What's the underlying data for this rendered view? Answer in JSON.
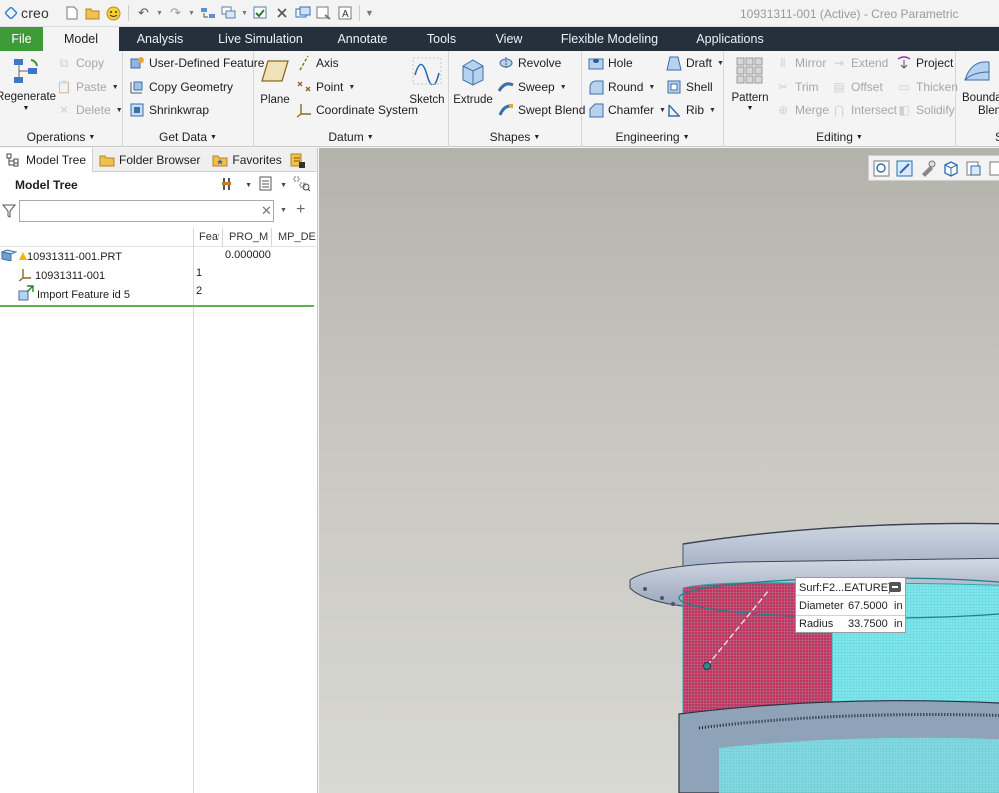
{
  "app": {
    "logo_text": "creo",
    "window_title": "10931311-001 (Active) - Creo Parametric"
  },
  "quick_access": [
    "new-icon",
    "open-icon",
    "smiley-icon",
    "undo-icon",
    "redo-icon",
    "regenerate-icon",
    "windows-icon",
    "check-icon",
    "close-window-icon",
    "switch-window-icon",
    "erase-icon",
    "text-style-icon",
    "customize-icon"
  ],
  "tabs": [
    {
      "label": "File"
    },
    {
      "label": "Model"
    },
    {
      "label": "Analysis"
    },
    {
      "label": "Live Simulation"
    },
    {
      "label": "Annotate"
    },
    {
      "label": "Tools"
    },
    {
      "label": "View"
    },
    {
      "label": "Flexible Modeling"
    },
    {
      "label": "Applications"
    }
  ],
  "ribbon": {
    "operations": {
      "label": "Operations",
      "regenerate": "Regenerate",
      "copy": "Copy",
      "paste": "Paste",
      "delete": "Delete"
    },
    "get_data": {
      "label": "Get Data",
      "udf": "User-Defined Feature",
      "copy_geometry": "Copy Geometry",
      "shrinkwrap": "Shrinkwrap"
    },
    "datum": {
      "label": "Datum",
      "plane": "Plane",
      "axis": "Axis",
      "point": "Point",
      "coordinate_system": "Coordinate System",
      "sketch": "Sketch"
    },
    "shapes": {
      "label": "Shapes",
      "extrude": "Extrude",
      "revolve": "Revolve",
      "sweep": "Sweep",
      "swept_blend": "Swept Blend"
    },
    "engineering": {
      "label": "Engineering",
      "hole": "Hole",
      "round": "Round",
      "chamfer": "Chamfer",
      "draft": "Draft",
      "shell": "Shell",
      "rib": "Rib"
    },
    "editing": {
      "label": "Editing",
      "pattern": "Pattern",
      "mirror": "Mirror",
      "trim": "Trim",
      "merge": "Merge",
      "extend": "Extend",
      "offset": "Offset",
      "intersect": "Intersect",
      "project": "Project",
      "thicken": "Thicken",
      "solidify": "Solidify"
    },
    "surfaces": {
      "boundary_blend_line1": "Bounda",
      "boundary_blend_line2": "Blend",
      "label_fragment": "S"
    }
  },
  "left_panel": {
    "tabs": [
      "Model Tree",
      "Folder Browser",
      "Favorites"
    ],
    "title": "Model Tree",
    "search": {
      "value": "",
      "placeholder": ""
    },
    "columns": [
      "Feat",
      "PRO_MP",
      "MP_DEN"
    ],
    "rows": [
      {
        "name": "10931311-001.PRT",
        "feat": "",
        "pro_mp": "0.000000"
      },
      {
        "name": "10931311-001",
        "feat": "1",
        "pro_mp": ""
      },
      {
        "name": "Import Feature id 5",
        "feat": "2",
        "pro_mp": ""
      }
    ]
  },
  "tooltip": {
    "title": "Surf:F2...EATURE)",
    "diameter_label": "Diameter",
    "diameter_value": "67.5000",
    "diameter_unit": "in",
    "radius_label": "Radius",
    "radius_value": "33.7500",
    "radius_unit": "in"
  },
  "colors": {
    "file_tab": "#3f9b3a",
    "tab_bar": "#24303c",
    "surface_highlight": "#c2345f",
    "mesh_cyan": "#7fe6ec"
  }
}
